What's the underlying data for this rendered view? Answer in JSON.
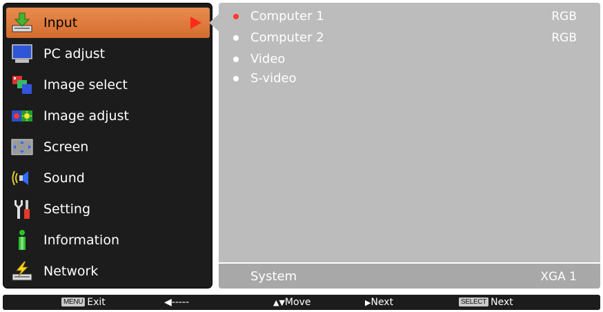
{
  "menu": {
    "items": [
      {
        "label": "Input",
        "icon": "input-icon",
        "selected": true
      },
      {
        "label": "PC adjust",
        "icon": "pc-adjust-icon"
      },
      {
        "label": "Image select",
        "icon": "image-select-icon"
      },
      {
        "label": "Image adjust",
        "icon": "image-adjust-icon"
      },
      {
        "label": "Screen",
        "icon": "screen-icon"
      },
      {
        "label": "Sound",
        "icon": "sound-icon"
      },
      {
        "label": "Setting",
        "icon": "setting-icon"
      },
      {
        "label": "Information",
        "icon": "information-icon"
      },
      {
        "label": "Network",
        "icon": "network-icon"
      }
    ]
  },
  "submenu": {
    "items": [
      {
        "label": "Computer 1",
        "value": "RGB",
        "active": true
      },
      {
        "label": "Computer 2",
        "value": "RGB"
      },
      {
        "label": "Video",
        "value": ""
      },
      {
        "label": "S-video",
        "value": ""
      }
    ],
    "footer": {
      "label": "System",
      "value": "XGA 1"
    }
  },
  "guide": {
    "menu_key": "MENU",
    "exit_label": "Exit",
    "back_label": "◀-----",
    "move_label": "Move",
    "next_label": "Next",
    "select_key": "SELECT",
    "select_next_label": "Next"
  },
  "colors": {
    "selected_bg": "#e07a3c",
    "panel_dark": "#1c1c1c",
    "panel_gray": "#bcbcbc",
    "active_dot": "#ff3b2e"
  }
}
